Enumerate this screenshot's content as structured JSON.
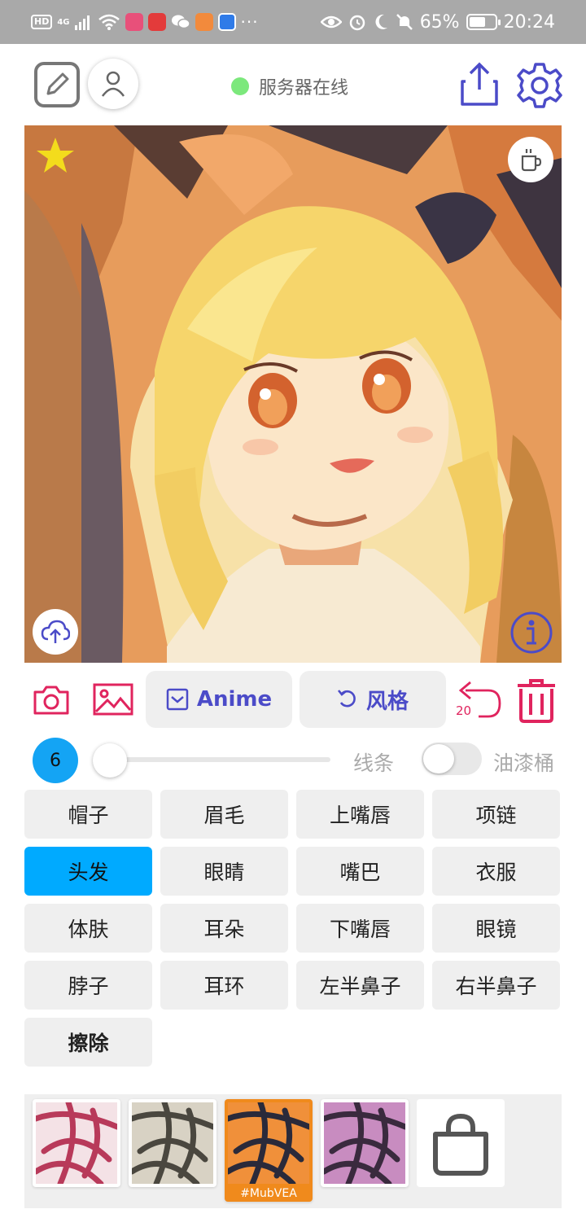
{
  "status_bar": {
    "hd": "HD",
    "network": "4G",
    "battery": "65%",
    "battery_level": 0.65,
    "time": "20:24",
    "more": "···"
  },
  "header": {
    "server_status": "服务器在线",
    "server_status_color": "#7ce87c"
  },
  "actions": {
    "anime_label": "Anime",
    "style_label": "风格",
    "undo_count": "20",
    "accent_color": "#4b4bc8",
    "danger_color": "#e0245e"
  },
  "brush": {
    "size": "6",
    "slider_value": 0,
    "lines_label": "线条",
    "bucket_label": "油漆桶",
    "bucket_enabled": false
  },
  "parts": [
    {
      "label": "帽子",
      "selected": false
    },
    {
      "label": "眉毛",
      "selected": false
    },
    {
      "label": "上嘴唇",
      "selected": false
    },
    {
      "label": "项链",
      "selected": false
    },
    {
      "label": "头发",
      "selected": true
    },
    {
      "label": "眼睛",
      "selected": false
    },
    {
      "label": "嘴巴",
      "selected": false
    },
    {
      "label": "衣服",
      "selected": false
    },
    {
      "label": "体肤",
      "selected": false
    },
    {
      "label": "耳朵",
      "selected": false
    },
    {
      "label": "下嘴唇",
      "selected": false
    },
    {
      "label": "眼镜",
      "selected": false
    },
    {
      "label": "脖子",
      "selected": false
    },
    {
      "label": "耳环",
      "selected": false
    },
    {
      "label": "左半鼻子",
      "selected": false
    },
    {
      "label": "右半鼻子",
      "selected": false
    },
    {
      "label": "擦除",
      "selected": false,
      "bold": true
    }
  ],
  "styles": [
    {
      "name": "style-red",
      "colors": [
        "#b83a5a",
        "#f4e2e6"
      ]
    },
    {
      "name": "style-gray",
      "colors": [
        "#4a473f",
        "#d8d2c4"
      ]
    },
    {
      "name": "style-tiger",
      "tag": "#MubVEA",
      "active": true,
      "colors": [
        "#2a2a3a",
        "#f0903a"
      ]
    },
    {
      "name": "style-purple",
      "colors": [
        "#3a2a3e",
        "#c88cc0"
      ]
    }
  ],
  "icons": {
    "edit": "edit-icon",
    "user": "user-icon",
    "share": "share-icon",
    "settings": "gear-icon",
    "favorite": "star-icon",
    "coffee": "coffee-icon",
    "upload": "cloud-upload-icon",
    "info": "info-icon",
    "camera": "camera-icon",
    "gallery": "image-icon",
    "undo": "undo-icon",
    "delete": "trash-icon",
    "shop": "shopping-bag-icon"
  }
}
